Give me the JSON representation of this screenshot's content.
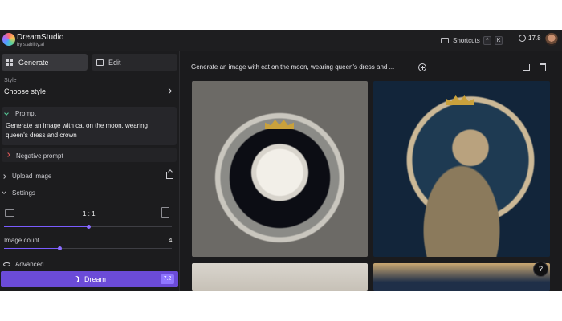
{
  "app": {
    "name": "DreamStudio",
    "subtitle": "by stability.ai"
  },
  "topbar": {
    "shortcuts_label": "Shortcuts",
    "shortcut_keys": [
      "^",
      "K"
    ],
    "credits": "17.8"
  },
  "sidebar": {
    "tabs": [
      {
        "label": "Generate",
        "icon": "grid-icon",
        "active": true
      },
      {
        "label": "Edit",
        "icon": "edit-icon",
        "active": false
      }
    ],
    "style": {
      "label": "Style",
      "value": "Choose style"
    },
    "prompt": {
      "label": "Prompt",
      "text": "Generate an image with cat on the moon, wearing queen's dress and crown"
    },
    "negative_prompt": {
      "label": "Negative prompt"
    },
    "upload_image": {
      "label": "Upload image"
    },
    "settings": {
      "label": "Settings",
      "aspect_ratio": "1 : 1",
      "aspect_ratio_slider": 0.5,
      "image_count_label": "Image count",
      "image_count": "4",
      "image_count_slider": 0.33
    },
    "advanced": {
      "label": "Advanced"
    },
    "dream": {
      "label": "Dream",
      "cost": "7.2"
    }
  },
  "main": {
    "prompt_title": "Generate an image with cat on the moon, wearing queen's dress and ..."
  },
  "colors": {
    "accent": "#6b4bd8",
    "background": "#1b1b1d"
  }
}
